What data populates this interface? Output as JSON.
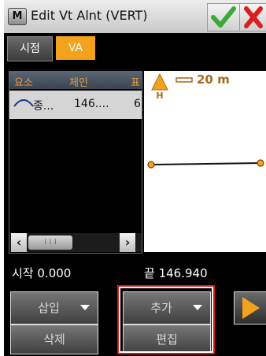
{
  "window": {
    "icon_letter": "M",
    "title": "Edit Vt Alnt (VERT)"
  },
  "tabs": [
    {
      "label": "시점"
    },
    {
      "label": "VA",
      "active": true
    }
  ],
  "element_list": {
    "columns": [
      "요소",
      "체인",
      "표"
    ],
    "rows": [
      {
        "type_icon": "vertical-curve-icon",
        "type": "종...",
        "station": "146....",
        "more": "6"
      }
    ]
  },
  "map": {
    "north_label": "H",
    "scale_label": "20 m"
  },
  "stations": {
    "start_label": "시작",
    "start_value": "0.000",
    "end_label": "끝",
    "end_value": "146.940"
  },
  "buttons": {
    "insert": "삽입",
    "add": "추가",
    "delete": "삭제",
    "edit": "편집"
  },
  "colors": {
    "accent": "#f2a21b",
    "ok_green": "#3aa935",
    "close_red": "#d92020",
    "highlight": "#e01414"
  }
}
